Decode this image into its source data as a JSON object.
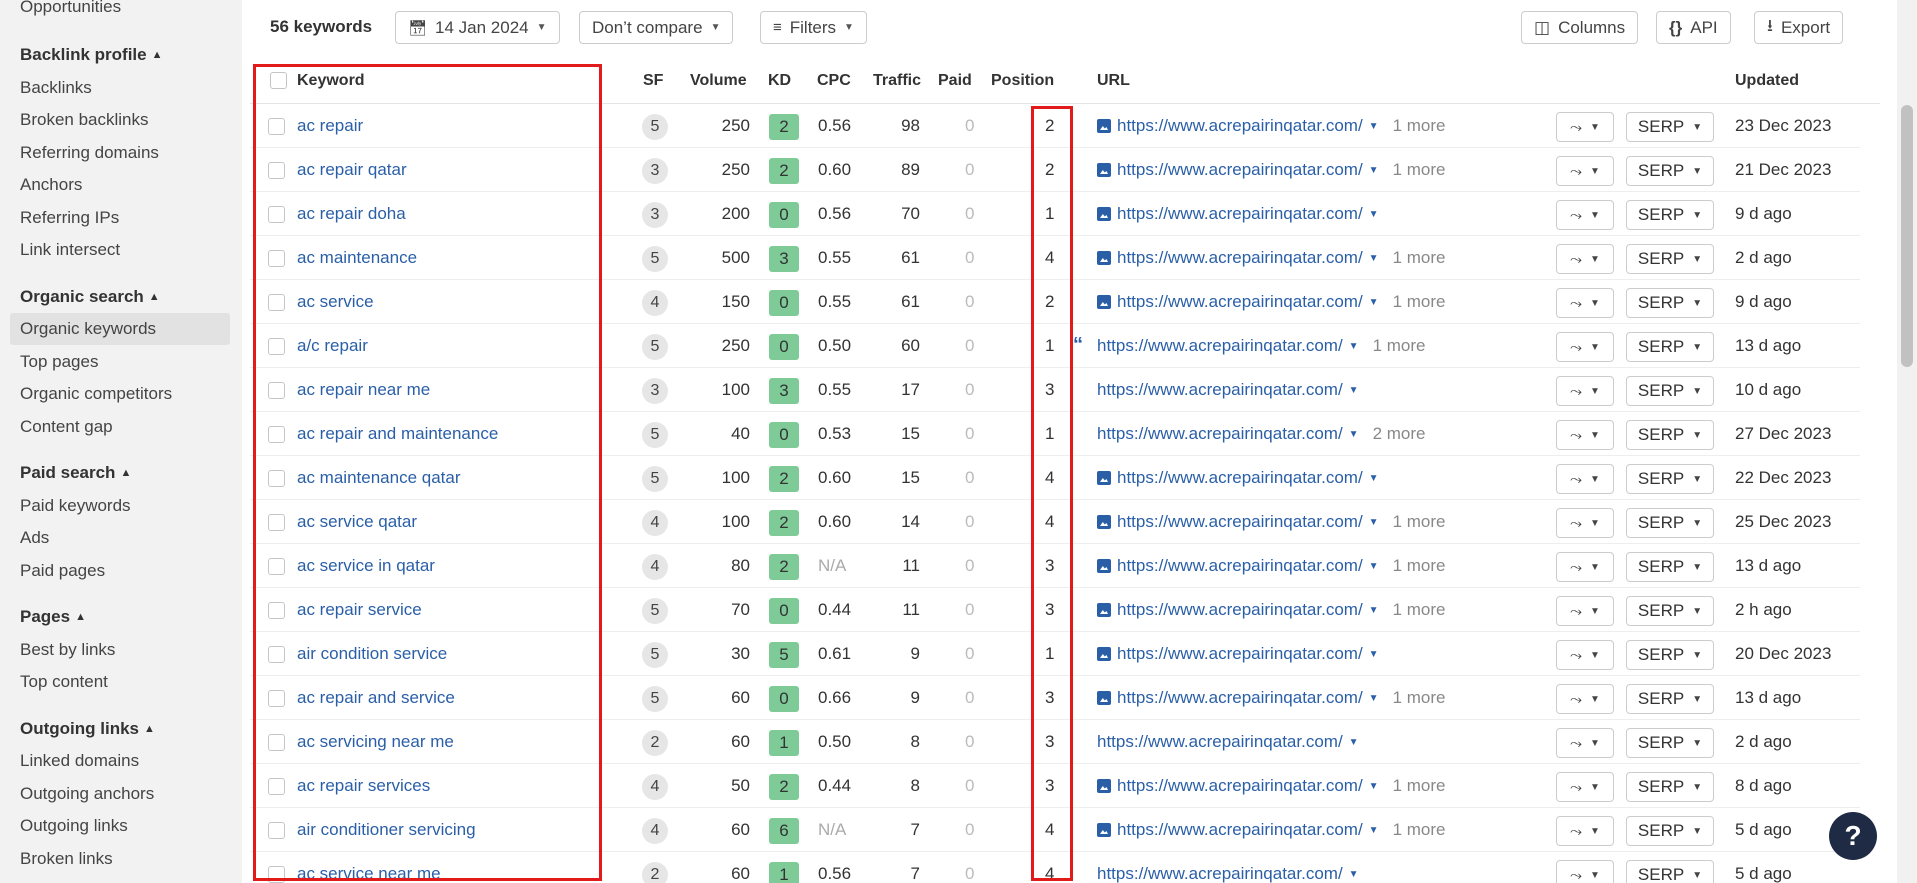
{
  "sidebar": {
    "top_item": "Opportunities",
    "sections": [
      {
        "title": "Backlink profile",
        "items": [
          "Backlinks",
          "Broken backlinks",
          "Referring domains",
          "Anchors",
          "Referring IPs",
          "Link intersect"
        ]
      },
      {
        "title": "Organic search",
        "items": [
          "Organic keywords",
          "Top pages",
          "Organic competitors",
          "Content gap"
        ]
      },
      {
        "title": "Paid search",
        "items": [
          "Paid keywords",
          "Ads",
          "Paid pages"
        ]
      },
      {
        "title": "Pages",
        "items": [
          "Best by links",
          "Top content"
        ]
      },
      {
        "title": "Outgoing links",
        "items": [
          "Linked domains",
          "Outgoing anchors",
          "Outgoing links",
          "Broken links"
        ]
      }
    ],
    "active_item": "Organic keywords"
  },
  "toolbar": {
    "keyword_count": "56 keywords",
    "date": "14 Jan 2024",
    "compare": "Don’t compare",
    "filters": "Filters",
    "columns": "Columns",
    "api": "API",
    "export": "Export"
  },
  "table": {
    "headers": {
      "keyword": "Keyword",
      "sf": "SF",
      "volume": "Volume",
      "kd": "KD",
      "cpc": "CPC",
      "traffic": "Traffic",
      "paid": "Paid",
      "position": "Position",
      "url": "URL",
      "updated": "Updated"
    },
    "serp_label": "SERP",
    "rows": [
      {
        "keyword": "ac repair",
        "sf": "5",
        "volume": "250",
        "kd": "2",
        "cpc": "0.56",
        "traffic": "98",
        "paid": "0",
        "position": "2",
        "url": "https://www.acrepairinqatar.com/",
        "url_icon": "image",
        "more": "1 more",
        "updated": "23 Dec 2023"
      },
      {
        "keyword": "ac repair qatar",
        "sf": "3",
        "volume": "250",
        "kd": "2",
        "cpc": "0.60",
        "traffic": "89",
        "paid": "0",
        "position": "2",
        "url": "https://www.acrepairinqatar.com/",
        "url_icon": "image",
        "more": "1 more",
        "updated": "21 Dec 2023"
      },
      {
        "keyword": "ac repair doha",
        "sf": "3",
        "volume": "200",
        "kd": "0",
        "cpc": "0.56",
        "traffic": "70",
        "paid": "0",
        "position": "1",
        "url": "https://www.acrepairinqatar.com/",
        "url_icon": "image",
        "more": "",
        "updated": "9 d ago"
      },
      {
        "keyword": "ac maintenance",
        "sf": "5",
        "volume": "500",
        "kd": "3",
        "cpc": "0.55",
        "traffic": "61",
        "paid": "0",
        "position": "4",
        "url": "https://www.acrepairinqatar.com/",
        "url_icon": "image",
        "more": "1 more",
        "updated": "2 d ago"
      },
      {
        "keyword": "ac service",
        "sf": "4",
        "volume": "150",
        "kd": "0",
        "cpc": "0.55",
        "traffic": "61",
        "paid": "0",
        "position": "2",
        "url": "https://www.acrepairinqatar.com/",
        "url_icon": "image",
        "more": "1 more",
        "updated": "9 d ago"
      },
      {
        "keyword": "a/c repair",
        "sf": "5",
        "volume": "250",
        "kd": "0",
        "cpc": "0.50",
        "traffic": "60",
        "paid": "0",
        "position": "1",
        "url": "https://www.acrepairinqatar.com/",
        "url_icon": "quote",
        "more": "1 more",
        "updated": "13 d ago"
      },
      {
        "keyword": "ac repair near me",
        "sf": "3",
        "volume": "100",
        "kd": "3",
        "cpc": "0.55",
        "traffic": "17",
        "paid": "0",
        "position": "3",
        "url": "https://www.acrepairinqatar.com/",
        "url_icon": "",
        "more": "",
        "updated": "10 d ago"
      },
      {
        "keyword": "ac repair and maintenance",
        "sf": "5",
        "volume": "40",
        "kd": "0",
        "cpc": "0.53",
        "traffic": "15",
        "paid": "0",
        "position": "1",
        "url": "https://www.acrepairinqatar.com/",
        "url_icon": "",
        "more": "2 more",
        "updated": "27 Dec 2023"
      },
      {
        "keyword": "ac maintenance qatar",
        "sf": "5",
        "volume": "100",
        "kd": "2",
        "cpc": "0.60",
        "traffic": "15",
        "paid": "0",
        "position": "4",
        "url": "https://www.acrepairinqatar.com/",
        "url_icon": "image",
        "more": "",
        "updated": "22 Dec 2023"
      },
      {
        "keyword": "ac service qatar",
        "sf": "4",
        "volume": "100",
        "kd": "2",
        "cpc": "0.60",
        "traffic": "14",
        "paid": "0",
        "position": "4",
        "url": "https://www.acrepairinqatar.com/",
        "url_icon": "image",
        "more": "1 more",
        "updated": "25 Dec 2023"
      },
      {
        "keyword": "ac service in qatar",
        "sf": "4",
        "volume": "80",
        "kd": "2",
        "cpc": "N/A",
        "traffic": "11",
        "paid": "0",
        "position": "3",
        "url": "https://www.acrepairinqatar.com/",
        "url_icon": "image",
        "more": "1 more",
        "updated": "13 d ago"
      },
      {
        "keyword": "ac repair service",
        "sf": "5",
        "volume": "70",
        "kd": "0",
        "cpc": "0.44",
        "traffic": "11",
        "paid": "0",
        "position": "3",
        "url": "https://www.acrepairinqatar.com/",
        "url_icon": "image",
        "more": "1 more",
        "updated": "2 h ago"
      },
      {
        "keyword": "air condition service",
        "sf": "5",
        "volume": "30",
        "kd": "5",
        "cpc": "0.61",
        "traffic": "9",
        "paid": "0",
        "position": "1",
        "url": "https://www.acrepairinqatar.com/",
        "url_icon": "image",
        "more": "",
        "updated": "20 Dec 2023"
      },
      {
        "keyword": "ac repair and service",
        "sf": "5",
        "volume": "60",
        "kd": "0",
        "cpc": "0.66",
        "traffic": "9",
        "paid": "0",
        "position": "3",
        "url": "https://www.acrepairinqatar.com/",
        "url_icon": "image",
        "more": "1 more",
        "updated": "13 d ago"
      },
      {
        "keyword": "ac servicing near me",
        "sf": "2",
        "volume": "60",
        "kd": "1",
        "cpc": "0.50",
        "traffic": "8",
        "paid": "0",
        "position": "3",
        "url": "https://www.acrepairinqatar.com/",
        "url_icon": "",
        "more": "",
        "updated": "2 d ago"
      },
      {
        "keyword": "ac repair services",
        "sf": "4",
        "volume": "50",
        "kd": "2",
        "cpc": "0.44",
        "traffic": "8",
        "paid": "0",
        "position": "3",
        "url": "https://www.acrepairinqatar.com/",
        "url_icon": "image",
        "more": "1 more",
        "updated": "8 d ago"
      },
      {
        "keyword": "air conditioner servicing",
        "sf": "4",
        "volume": "60",
        "kd": "6",
        "cpc": "N/A",
        "traffic": "7",
        "paid": "0",
        "position": "4",
        "url": "https://www.acrepairinqatar.com/",
        "url_icon": "image",
        "more": "1 more",
        "updated": "5 d ago"
      },
      {
        "keyword": "ac service near me",
        "sf": "2",
        "volume": "60",
        "kd": "1",
        "cpc": "0.56",
        "traffic": "7",
        "paid": "0",
        "position": "4",
        "url": "https://www.acrepairinqatar.com/",
        "url_icon": "",
        "more": "",
        "updated": "5 d ago"
      }
    ]
  },
  "help_label": "?"
}
